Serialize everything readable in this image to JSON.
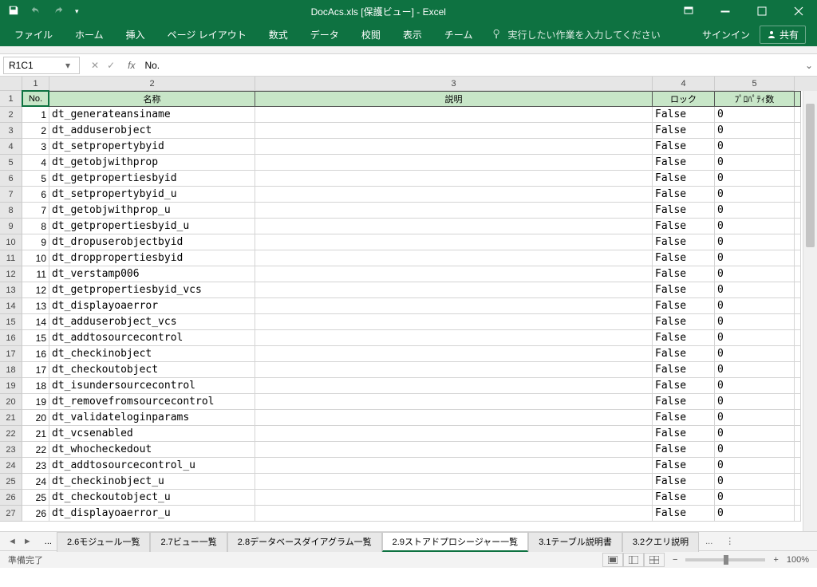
{
  "title": "DocAcs.xls [保護ビュー] - Excel",
  "qat_dropdown": "▾",
  "ribbon": {
    "tabs": [
      "ファイル",
      "ホーム",
      "挿入",
      "ページ レイアウト",
      "数式",
      "データ",
      "校閲",
      "表示",
      "チーム"
    ],
    "tellme": "実行したい作業を入力してください",
    "signin": "サインイン",
    "share": "共有"
  },
  "namebox": "R1C1",
  "formula": "No.",
  "colnums": [
    "1",
    "2",
    "3",
    "4",
    "5"
  ],
  "rownums": [
    "1",
    "2",
    "3",
    "4",
    "5",
    "6",
    "7",
    "8",
    "9",
    "10",
    "11",
    "12",
    "13",
    "14",
    "15",
    "16",
    "17",
    "18",
    "19",
    "20",
    "21",
    "22",
    "23",
    "24",
    "25",
    "26",
    "27"
  ],
  "headers": {
    "no": "No.",
    "name": "名称",
    "desc": "説明",
    "lock": "ロック",
    "props": "ﾌﾟﾛﾊﾟﾃｨ数"
  },
  "rows": [
    {
      "no": "1",
      "name": "dt_generateansiname",
      "lock": "False",
      "props": "0"
    },
    {
      "no": "2",
      "name": "dt_adduserobject",
      "lock": "False",
      "props": "0"
    },
    {
      "no": "3",
      "name": "dt_setpropertybyid",
      "lock": "False",
      "props": "0"
    },
    {
      "no": "4",
      "name": "dt_getobjwithprop",
      "lock": "False",
      "props": "0"
    },
    {
      "no": "5",
      "name": "dt_getpropertiesbyid",
      "lock": "False",
      "props": "0"
    },
    {
      "no": "6",
      "name": "dt_setpropertybyid_u",
      "lock": "False",
      "props": "0"
    },
    {
      "no": "7",
      "name": "dt_getobjwithprop_u",
      "lock": "False",
      "props": "0"
    },
    {
      "no": "8",
      "name": "dt_getpropertiesbyid_u",
      "lock": "False",
      "props": "0"
    },
    {
      "no": "9",
      "name": "dt_dropuserobjectbyid",
      "lock": "False",
      "props": "0"
    },
    {
      "no": "10",
      "name": "dt_droppropertiesbyid",
      "lock": "False",
      "props": "0"
    },
    {
      "no": "11",
      "name": "dt_verstamp006",
      "lock": "False",
      "props": "0"
    },
    {
      "no": "12",
      "name": "dt_getpropertiesbyid_vcs",
      "lock": "False",
      "props": "0"
    },
    {
      "no": "13",
      "name": "dt_displayoaerror",
      "lock": "False",
      "props": "0"
    },
    {
      "no": "14",
      "name": "dt_adduserobject_vcs",
      "lock": "False",
      "props": "0"
    },
    {
      "no": "15",
      "name": "dt_addtosourcecontrol",
      "lock": "False",
      "props": "0"
    },
    {
      "no": "16",
      "name": "dt_checkinobject",
      "lock": "False",
      "props": "0"
    },
    {
      "no": "17",
      "name": "dt_checkoutobject",
      "lock": "False",
      "props": "0"
    },
    {
      "no": "18",
      "name": "dt_isundersourcecontrol",
      "lock": "False",
      "props": "0"
    },
    {
      "no": "19",
      "name": "dt_removefromsourcecontrol",
      "lock": "False",
      "props": "0"
    },
    {
      "no": "20",
      "name": "dt_validateloginparams",
      "lock": "False",
      "props": "0"
    },
    {
      "no": "21",
      "name": "dt_vcsenabled",
      "lock": "False",
      "props": "0"
    },
    {
      "no": "22",
      "name": "dt_whocheckedout",
      "lock": "False",
      "props": "0"
    },
    {
      "no": "23",
      "name": "dt_addtosourcecontrol_u",
      "lock": "False",
      "props": "0"
    },
    {
      "no": "24",
      "name": "dt_checkinobject_u",
      "lock": "False",
      "props": "0"
    },
    {
      "no": "25",
      "name": "dt_checkoutobject_u",
      "lock": "False",
      "props": "0"
    },
    {
      "no": "26",
      "name": "dt_displayoaerror_u",
      "lock": "False",
      "props": "0"
    }
  ],
  "sheettabs": {
    "ellipsis": "...",
    "items": [
      "2.6モジュール一覧",
      "2.7ビュー一覧",
      "2.8データベースダイアグラム一覧",
      "2.9ストアドプロシージャー一覧",
      "3.1テーブル説明書",
      "3.2クエリ説明"
    ],
    "more": "..."
  },
  "status": {
    "ready": "準備完了",
    "zoom": "100%",
    "minus": "−",
    "plus": "+"
  }
}
